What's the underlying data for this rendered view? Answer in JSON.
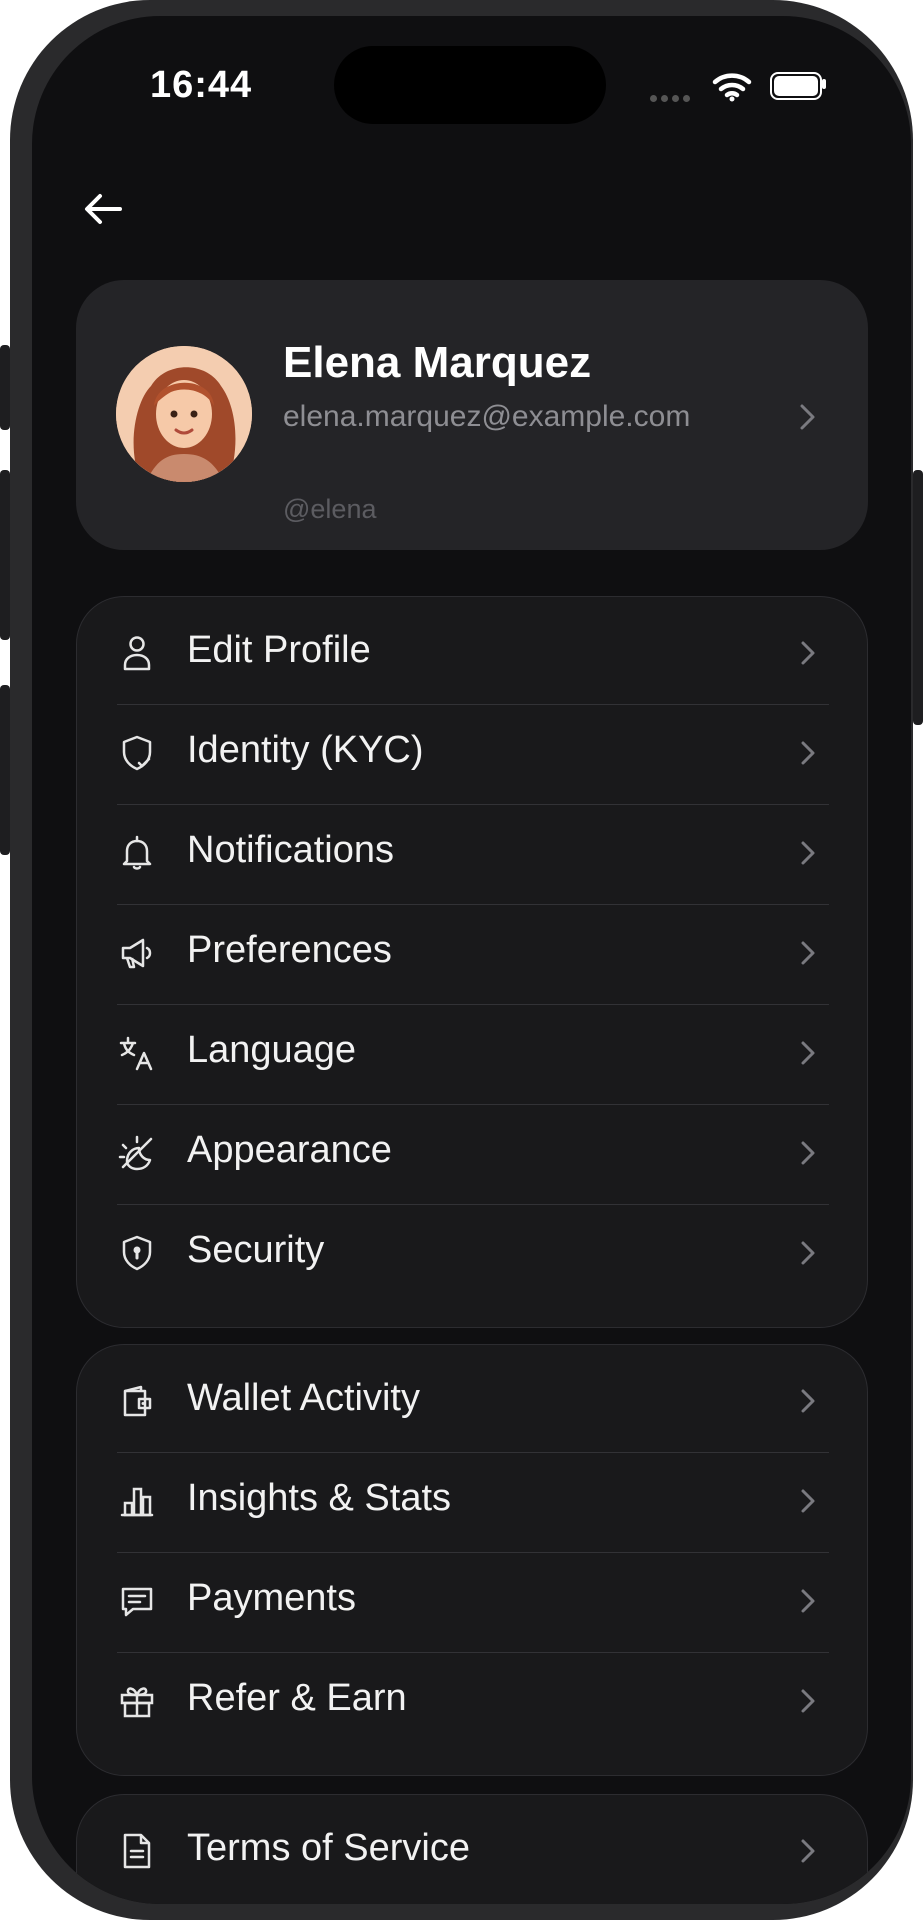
{
  "status_bar": {
    "time": "16:44"
  },
  "profile": {
    "name": "Elena Marquez",
    "email": "elena.marquez@example.com",
    "handle": "@elena"
  },
  "menu_group_1": [
    {
      "label": "Edit Profile",
      "icon": "user-icon"
    },
    {
      "label": "Identity (KYC)",
      "icon": "shield-check-icon"
    },
    {
      "label": "Notifications",
      "icon": "bell-icon"
    },
    {
      "label": "Preferences",
      "icon": "megaphone-icon"
    },
    {
      "label": "Language",
      "icon": "translate-icon"
    },
    {
      "label": "Appearance",
      "icon": "sun-moon-icon"
    },
    {
      "label": "Security",
      "icon": "shield-lock-icon"
    }
  ],
  "menu_group_2": [
    {
      "label": "Wallet Activity",
      "icon": "wallet-icon"
    },
    {
      "label": "Insights & Stats",
      "icon": "bar-chart-icon"
    },
    {
      "label": "Payments",
      "icon": "message-icon"
    },
    {
      "label": "Refer & Earn",
      "icon": "gift-icon"
    }
  ],
  "menu_group_3": [
    {
      "label": "Terms of Service",
      "icon": "document-icon"
    }
  ]
}
